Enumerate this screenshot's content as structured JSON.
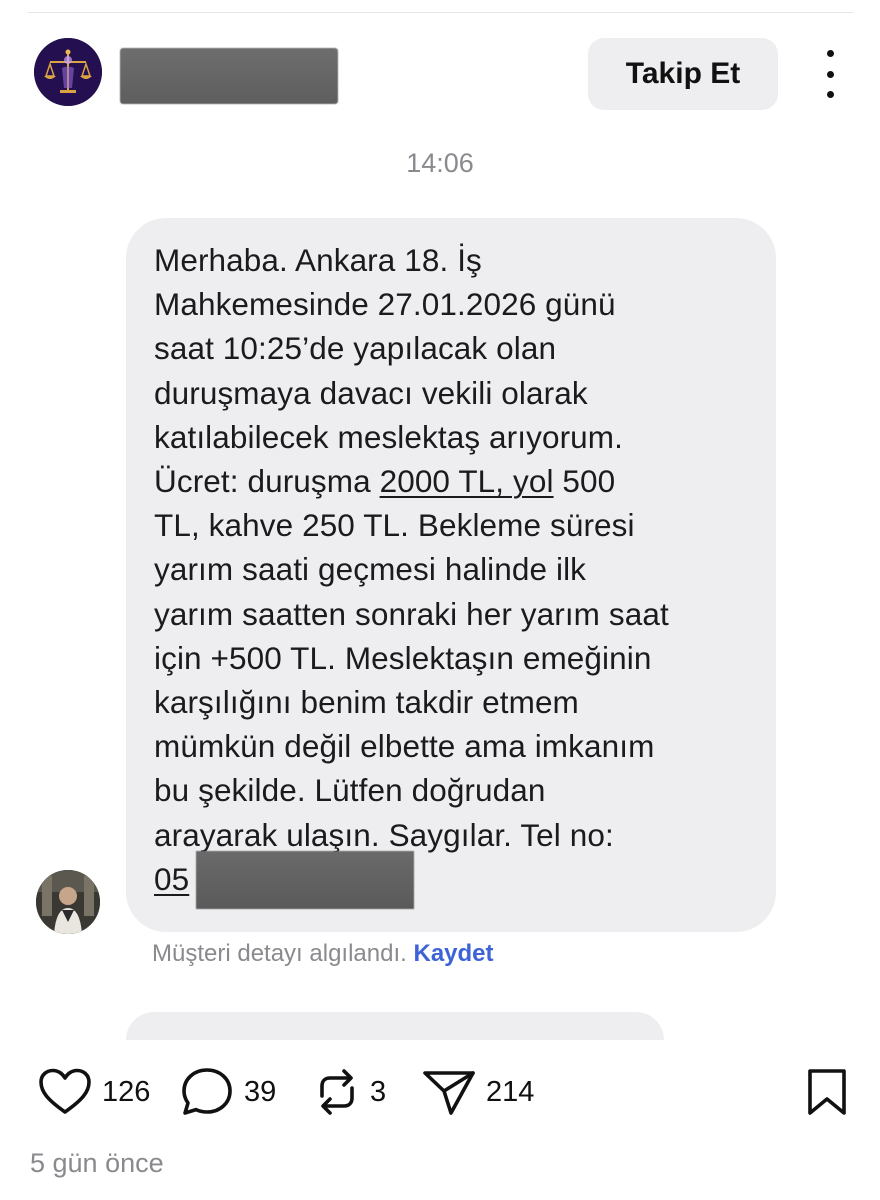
{
  "header": {
    "follow_label": "Takip Et"
  },
  "conversation": {
    "timestamp": "14:06",
    "message_lines": [
      "Merhaba. Ankara 18. İş",
      "Mahkemesinde 27.01.2026 günü",
      "saat 10:25’de yapılacak olan",
      "duruşmaya davacı vekili olarak",
      "katılabilecek meslektaş arıyorum.",
      "Ücret: duruşma ",
      "TL, kahve 250 TL. Bekleme süresi",
      "yarım  saati geçmesi halinde ilk",
      "yarım saatten sonraki her yarım saat",
      "için +500 TL. Meslektaşın emeğinin",
      "karşılığını benim takdir etmem",
      "mümkün değil elbette ama imkanım",
      "bu şekilde. Lütfen doğrudan",
      "arayarak ulaşın. Saygılar. Tel no:"
    ],
    "fee_link": "2000 TL, yol",
    "fee_after": " 500",
    "phone_prefix": "05",
    "detected_note": "Müşteri detayı algılandı.",
    "save_label": "Kaydet"
  },
  "actions": {
    "likes": "126",
    "replies": "39",
    "reposts": "3",
    "shares": "214"
  },
  "post_age": "5 gün önce",
  "icons": {
    "like": "heart-icon",
    "reply": "speech-bubble-icon",
    "repost": "repost-arrows-icon",
    "share": "paper-plane-icon",
    "bookmark": "bookmark-icon",
    "more": "vertical-ellipsis-icon"
  }
}
